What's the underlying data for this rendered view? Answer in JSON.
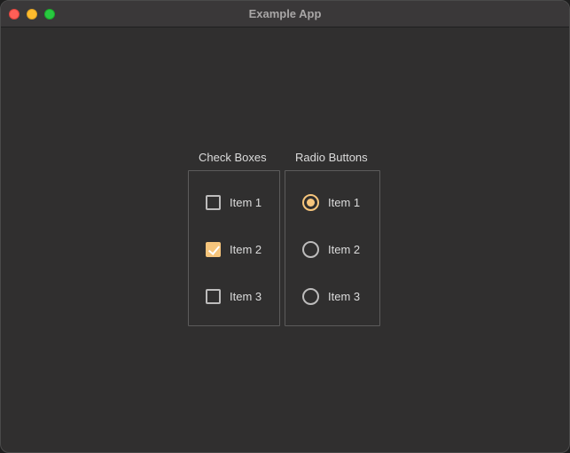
{
  "window": {
    "title": "Example App"
  },
  "colors": {
    "accent": "#f6c57c",
    "background": "#302f2f",
    "titlebar": "#3a3839"
  },
  "checkboxes": {
    "label": "Check Boxes",
    "items": [
      {
        "label": "Item 1",
        "checked": false
      },
      {
        "label": "Item 2",
        "checked": true
      },
      {
        "label": "Item 3",
        "checked": false
      }
    ]
  },
  "radios": {
    "label": "Radio Buttons",
    "items": [
      {
        "label": "Item 1",
        "selected": true
      },
      {
        "label": "Item 2",
        "selected": false
      },
      {
        "label": "Item 3",
        "selected": false
      }
    ]
  }
}
